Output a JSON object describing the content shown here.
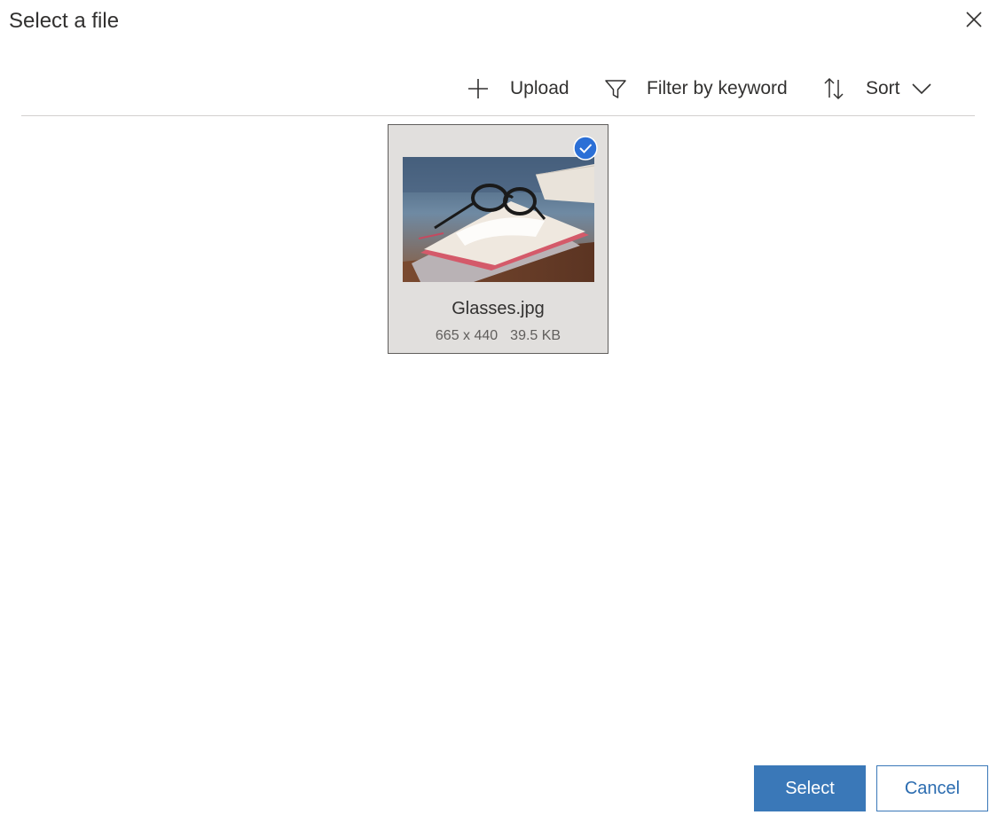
{
  "dialog": {
    "title": "Select a file"
  },
  "toolbar": {
    "upload_label": "Upload",
    "filter_label": "Filter by keyword",
    "sort_label": "Sort"
  },
  "files": [
    {
      "name": "Glasses.jpg",
      "dimensions": "665 x 440",
      "size": "39.5 KB",
      "selected": true,
      "thumbnail_icon": "glasses-on-book-photo"
    }
  ],
  "footer": {
    "select_label": "Select",
    "cancel_label": "Cancel"
  },
  "colors": {
    "accent": "#3a78b8",
    "check_badge": "#2b6fd6",
    "tile_background": "#e1dfdd",
    "divider": "#d2d0ce"
  },
  "icons": {
    "close": "close-icon",
    "upload": "plus-icon",
    "filter": "filter-funnel-icon",
    "sort": "sort-arrows-icon",
    "sort_dropdown": "chevron-down-icon",
    "selected": "checkmark-circle-icon"
  }
}
